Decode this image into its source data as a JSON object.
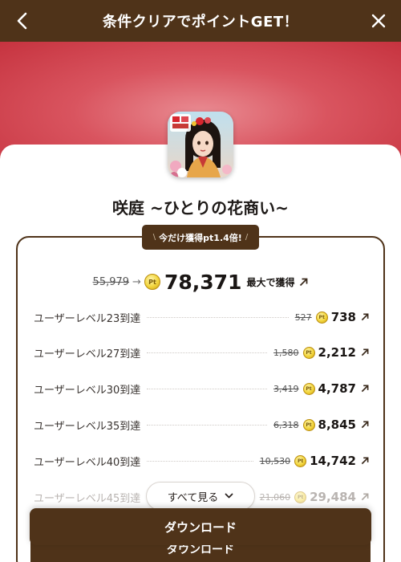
{
  "header": {
    "title": "条件クリアでポイントGET！",
    "back_icon": "chevron-left-icon",
    "close_icon": "close-icon"
  },
  "app": {
    "title": "咲庭 ~ひとりの花商い~",
    "icon": "app-icon-flower-girl"
  },
  "badge": {
    "left_deco": "\\",
    "text": "今だけ獲得pt1.4倍!",
    "right_deco": "/"
  },
  "max_reward": {
    "old_value": "55,979",
    "arrow": "→",
    "pt_label": "Pt",
    "new_value": "78,371",
    "label": "最大で獲得"
  },
  "tasks": [
    {
      "label": "ユーザーレベル23到達",
      "old": "527",
      "new": "738"
    },
    {
      "label": "ユーザーレベル27到達",
      "old": "1,580",
      "new": "2,212"
    },
    {
      "label": "ユーザーレベル30到達",
      "old": "3,419",
      "new": "4,787"
    },
    {
      "label": "ユーザーレベル35到達",
      "old": "6,318",
      "new": "8,845"
    },
    {
      "label": "ユーザーレベル40到達",
      "old": "10,530",
      "new": "14,742"
    },
    {
      "label": "ユーザーレベル45到達",
      "old": "21,060",
      "new": "29,484"
    }
  ],
  "see_all": {
    "label": "すべて見る"
  },
  "download": {
    "label": "ダウンロード"
  },
  "colors": {
    "brand_brown": "#4f3319",
    "hero_red": "#d9545f",
    "coin_gold": "#f2d53c"
  }
}
